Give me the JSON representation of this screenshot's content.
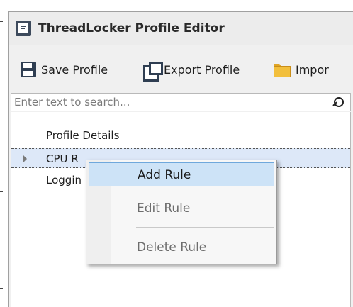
{
  "window": {
    "title": "ThreadLocker Profile Editor"
  },
  "toolbar": {
    "save_label": "Save Profile",
    "export_label": "Export Profile",
    "import_label": "Impor"
  },
  "search": {
    "placeholder": "Enter text to search...",
    "value": ""
  },
  "tree": {
    "items": [
      {
        "label": "Profile Details",
        "expandable": false
      },
      {
        "label": "CPU Rules",
        "visible_label": "CPU R",
        "expandable": true,
        "selected": true
      },
      {
        "label": "Loggin",
        "expandable": false
      }
    ]
  },
  "context_menu": {
    "items": [
      {
        "label": "Add Rule",
        "highlighted": true,
        "enabled": true
      },
      {
        "label": "Edit Rule",
        "highlighted": false,
        "enabled": false
      },
      {
        "label": "Delete Rule",
        "highlighted": false,
        "enabled": false
      }
    ]
  },
  "icons": {
    "app": "app-logo-icon",
    "save": "floppy-disk-icon",
    "export": "export-windows-icon",
    "import": "open-folder-icon",
    "search": "search-icon",
    "expander": "expand-arrow-icon"
  },
  "colors": {
    "selection_bg": "#dde8f8",
    "menu_highlight_bg": "#cde3f7",
    "menu_highlight_border": "#6fa8dc",
    "disabled_text": "#6d6d6d"
  }
}
